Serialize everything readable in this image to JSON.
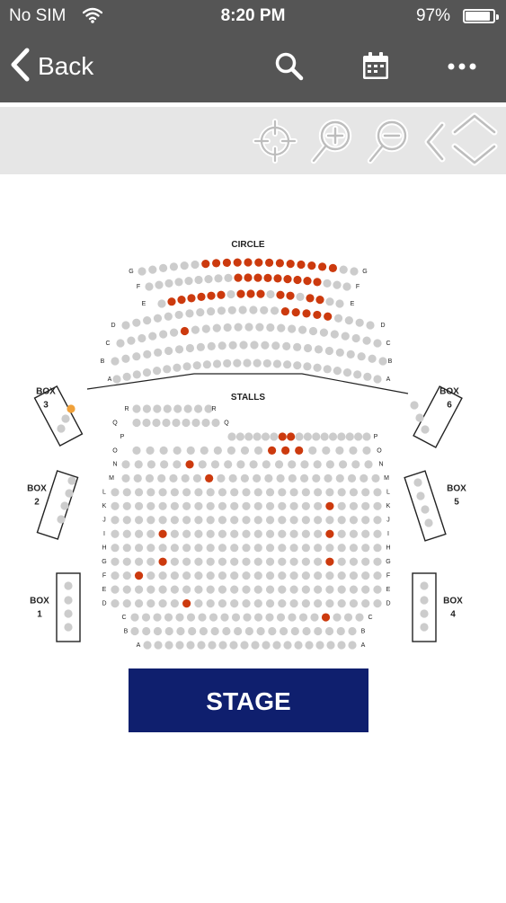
{
  "status_bar": {
    "carrier": "No SIM",
    "time": "8:20 PM",
    "battery": "97%",
    "battery_level": 0.97,
    "wifi_icon": "wifi-icon",
    "battery_icon": "battery-icon"
  },
  "nav": {
    "back_label": "Back",
    "back_icon": "chevron-left-icon",
    "search_icon": "search-icon",
    "calendar_icon": "calendar-icon",
    "more_icon": "more-horizontal-icon"
  },
  "toolbar": {
    "icons": [
      "crosshair-icon",
      "zoom-in-icon",
      "zoom-out-icon",
      "pan-left-icon",
      "pan-up-icon",
      "pan-down-icon"
    ]
  },
  "colors": {
    "header_bg": "#555555",
    "toolbar_bg": "#e6e6e6",
    "seat_available": "#cccccc",
    "seat_selected": "#cc3a0e",
    "stage_bg": "#0f1f6e",
    "stage_text": "#ffffff"
  },
  "seatmap": {
    "circle_label": "CIRCLE",
    "stalls_label": "STALLS",
    "stage_label": "STAGE",
    "circle_rows": [
      "G",
      "F",
      "E",
      "D",
      "C",
      "B",
      "A"
    ],
    "stalls_rows": [
      "R",
      "Q",
      "P",
      "O",
      "N",
      "M",
      "L",
      "K",
      "J",
      "I",
      "H",
      "G",
      "F",
      "E",
      "D",
      "C",
      "B",
      "A"
    ],
    "boxes": [
      {
        "id": "3",
        "label": "BOX",
        "number": "3"
      },
      {
        "id": "6",
        "label": "BOX",
        "number": "6"
      },
      {
        "id": "2",
        "label": "BOX",
        "number": "2"
      },
      {
        "id": "5",
        "label": "BOX",
        "number": "5"
      },
      {
        "id": "1",
        "label": "BOX",
        "number": "1"
      },
      {
        "id": "4",
        "label": "BOX",
        "number": "4"
      }
    ]
  }
}
